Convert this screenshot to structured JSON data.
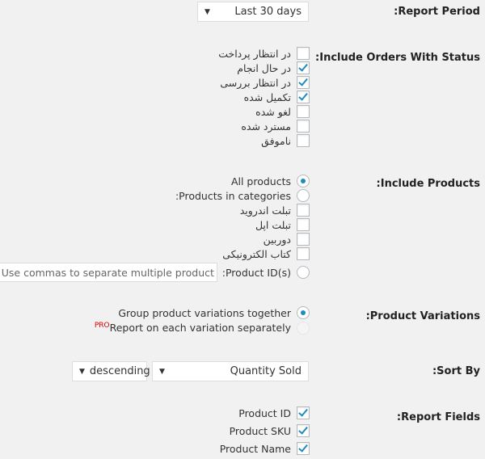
{
  "report_period": {
    "label": "Report Period:",
    "value": "Last 30 days"
  },
  "order_status": {
    "label": "Include Orders With Status:",
    "items": [
      {
        "label": "در انتظار پرداخت",
        "checked": false
      },
      {
        "label": "در حال انجام",
        "checked": true
      },
      {
        "label": "در انتظار بررسی",
        "checked": true
      },
      {
        "label": "تکمیل شده",
        "checked": true
      },
      {
        "label": "لغو شده",
        "checked": false
      },
      {
        "label": "مسترد شده",
        "checked": false
      },
      {
        "label": "ناموفق",
        "checked": false
      }
    ]
  },
  "include_products": {
    "label": "Include Products:",
    "all_products": "All products",
    "in_categories": "Products in categories:",
    "categories": [
      {
        "label": "تبلت اندروید",
        "checked": false
      },
      {
        "label": "تبلت اپل",
        "checked": false
      },
      {
        "label": "دوربین",
        "checked": false
      },
      {
        "label": "کتاب الکترونیکی",
        "checked": false
      }
    ],
    "product_ids": "Product ID(s):",
    "product_ids_placeholder": "Use commas to separate multiple product IDs",
    "selected": "all_products"
  },
  "variations": {
    "label": "Product Variations:",
    "group": "Group product variations together",
    "separate": "Report on each variation separately",
    "pro_badge": "PRO"
  },
  "sort_by": {
    "label": "Sort By:",
    "field": "Quantity Sold",
    "order": "descending"
  },
  "report_fields": {
    "label": "Report Fields:",
    "items": [
      {
        "label": "Product ID",
        "checked": true
      },
      {
        "label": "Product SKU",
        "checked": true
      },
      {
        "label": "Product Name",
        "checked": true
      }
    ]
  },
  "colors": {
    "accent": "#1e8cbe",
    "pro": "#dd0000",
    "background": "#f1f1f1"
  }
}
